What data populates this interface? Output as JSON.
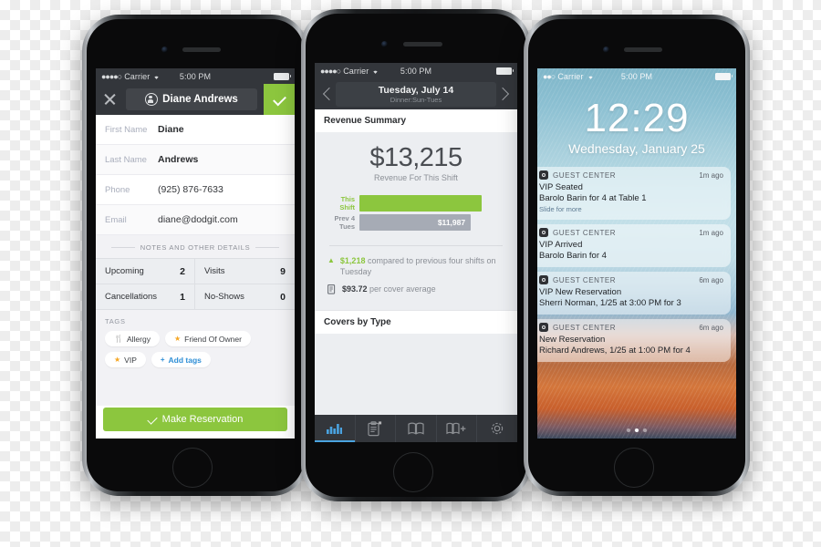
{
  "scene": {
    "title": "Three iPhones showing restaurant guest management app screens"
  },
  "phone_left": {
    "status_bar": {
      "signal": "●●●●○",
      "carrier": "Carrier",
      "wifi": "wifi-icon",
      "time": "5:00 PM"
    },
    "navbar": {
      "close_label": "×",
      "guest_name": "Diane Andrews",
      "person_icon": "person-icon",
      "confirm_label": "✓"
    },
    "form": {
      "rows": [
        {
          "label": "First Name",
          "value": "Diane"
        },
        {
          "label": "Last Name",
          "value": "Andrews"
        },
        {
          "label": "Phone",
          "value": "(925) 876-7633"
        },
        {
          "label": "Email",
          "value": "diane@dodgit.com"
        }
      ]
    },
    "section_divider": "NOTES AND OTHER DETAILS",
    "stats": [
      {
        "key": "Upcoming",
        "value": "2"
      },
      {
        "key": "Visits",
        "value": "9"
      },
      {
        "key": "Cancellations",
        "value": "1"
      },
      {
        "key": "No-Shows",
        "value": "0"
      }
    ],
    "tags": {
      "heading": "TAGS",
      "items": [
        {
          "icon": "🍴",
          "icon_name": "utensils-icon",
          "label": "Allergy",
          "kind": "normal"
        },
        {
          "icon": "★",
          "icon_name": "star-icon",
          "label": "Friend Of Owner",
          "kind": "normal"
        },
        {
          "icon": "★",
          "icon_name": "star-icon",
          "label": "VIP",
          "kind": "normal"
        },
        {
          "icon": "+",
          "icon_name": "plus-icon",
          "label": "Add tags",
          "kind": "add"
        }
      ]
    },
    "cta": {
      "label": "Make Reservation",
      "check": "✓",
      "color": "#8cc63e"
    }
  },
  "phone_middle": {
    "status_bar": {
      "signal": "●●●●○",
      "carrier": "Carrier",
      "wifi": "wifi-icon",
      "time": "5:00 PM"
    },
    "datebar": {
      "prev_icon": "chevron-left-icon",
      "next_icon": "chevron-right-icon",
      "date": "Tuesday, July 14",
      "shift": "Dinner:Sun-Tues"
    },
    "revenue_card": {
      "header": "Revenue Summary",
      "amount": "$13,215",
      "amount_caption": "Revenue For This Shift",
      "note_change": "compared to previous four shifts on Tuesday",
      "note_change_value": "$1,218",
      "note_avg_value": "$93.72",
      "note_avg": "per cover average",
      "up_arrow": "▲",
      "receipt_icon": "receipt-icon"
    },
    "covers_card": {
      "header": "Covers by Type"
    },
    "tabbar": {
      "items": [
        {
          "name": "chart-bar-icon",
          "label": "Reports",
          "active": true
        },
        {
          "name": "clipboard-icon",
          "label": "Reservations",
          "active": false,
          "badge": true
        },
        {
          "name": "book-icon",
          "label": "Floorplan",
          "active": false
        },
        {
          "name": "book-plus-icon",
          "label": "Add Reservation",
          "active": false
        },
        {
          "name": "gear-icon",
          "label": "Settings",
          "active": false
        }
      ]
    },
    "chart_data": {
      "type": "bar",
      "title": "Revenue Summary",
      "orientation": "horizontal",
      "categories": [
        "This Shift",
        "Prev 4 Tues"
      ],
      "values": [
        13215,
        11987
      ],
      "labels": [
        "",
        "$11,987"
      ],
      "colors": [
        "#8cc63e",
        "#a6abb5"
      ],
      "xlabel": "",
      "ylabel": "",
      "xlim": [
        0,
        13215
      ],
      "grid": false,
      "legend": "none"
    }
  },
  "phone_right": {
    "status_bar": {
      "signal": "●●○",
      "carrier": "Carrier",
      "wifi": "wifi-icon",
      "time": "5:00 PM"
    },
    "lock_screen": {
      "clock": "12:29",
      "date": "Wednesday, January 25",
      "notifications": [
        {
          "app": "GUEST CENTER",
          "ago": "1m ago",
          "title": "VIP Seated",
          "subtitle": "Barolo Barin for 4 at Table 1",
          "slide": "Slide for more"
        },
        {
          "app": "GUEST CENTER",
          "ago": "1m ago",
          "title": "VIP Arrived",
          "subtitle": "Barolo Barin for 4",
          "slide": ""
        },
        {
          "app": "GUEST CENTER",
          "ago": "6m ago",
          "title": "VIP New Reservation",
          "subtitle": "Sherri Norman, 1/25 at 3:00 PM for 3",
          "slide": ""
        },
        {
          "app": "GUEST CENTER",
          "ago": "6m ago",
          "title": "New Reservation",
          "subtitle": "Richard Andrews, 1/25 at 1:00 PM for 4",
          "slide": ""
        }
      ],
      "page_dots": {
        "count": 3,
        "active_index": 1
      }
    }
  }
}
